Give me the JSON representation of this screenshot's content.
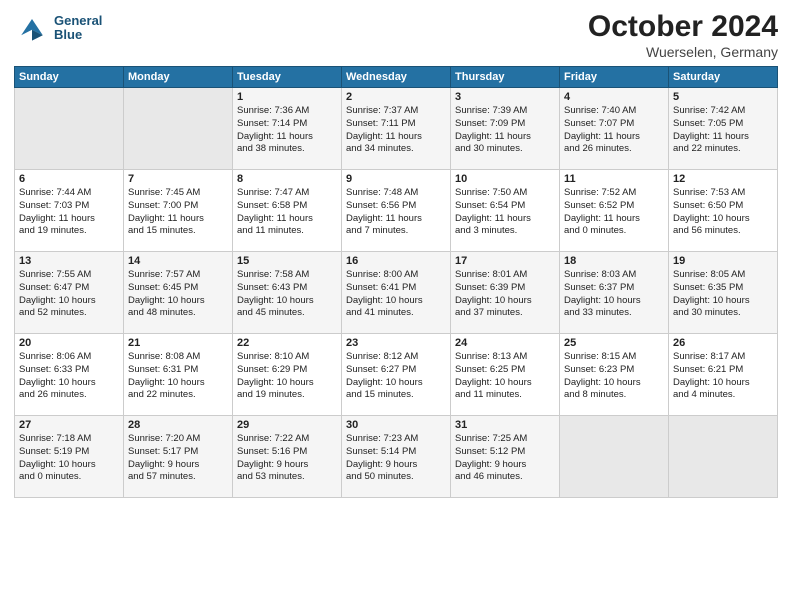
{
  "header": {
    "logo_line1": "General",
    "logo_line2": "Blue",
    "month": "October 2024",
    "location": "Wuerselen, Germany"
  },
  "weekdays": [
    "Sunday",
    "Monday",
    "Tuesday",
    "Wednesday",
    "Thursday",
    "Friday",
    "Saturday"
  ],
  "weeks": [
    [
      {
        "day": "",
        "content": ""
      },
      {
        "day": "",
        "content": ""
      },
      {
        "day": "1",
        "content": "Sunrise: 7:36 AM\nSunset: 7:14 PM\nDaylight: 11 hours\nand 38 minutes."
      },
      {
        "day": "2",
        "content": "Sunrise: 7:37 AM\nSunset: 7:11 PM\nDaylight: 11 hours\nand 34 minutes."
      },
      {
        "day": "3",
        "content": "Sunrise: 7:39 AM\nSunset: 7:09 PM\nDaylight: 11 hours\nand 30 minutes."
      },
      {
        "day": "4",
        "content": "Sunrise: 7:40 AM\nSunset: 7:07 PM\nDaylight: 11 hours\nand 26 minutes."
      },
      {
        "day": "5",
        "content": "Sunrise: 7:42 AM\nSunset: 7:05 PM\nDaylight: 11 hours\nand 22 minutes."
      }
    ],
    [
      {
        "day": "6",
        "content": "Sunrise: 7:44 AM\nSunset: 7:03 PM\nDaylight: 11 hours\nand 19 minutes."
      },
      {
        "day": "7",
        "content": "Sunrise: 7:45 AM\nSunset: 7:00 PM\nDaylight: 11 hours\nand 15 minutes."
      },
      {
        "day": "8",
        "content": "Sunrise: 7:47 AM\nSunset: 6:58 PM\nDaylight: 11 hours\nand 11 minutes."
      },
      {
        "day": "9",
        "content": "Sunrise: 7:48 AM\nSunset: 6:56 PM\nDaylight: 11 hours\nand 7 minutes."
      },
      {
        "day": "10",
        "content": "Sunrise: 7:50 AM\nSunset: 6:54 PM\nDaylight: 11 hours\nand 3 minutes."
      },
      {
        "day": "11",
        "content": "Sunrise: 7:52 AM\nSunset: 6:52 PM\nDaylight: 11 hours\nand 0 minutes."
      },
      {
        "day": "12",
        "content": "Sunrise: 7:53 AM\nSunset: 6:50 PM\nDaylight: 10 hours\nand 56 minutes."
      }
    ],
    [
      {
        "day": "13",
        "content": "Sunrise: 7:55 AM\nSunset: 6:47 PM\nDaylight: 10 hours\nand 52 minutes."
      },
      {
        "day": "14",
        "content": "Sunrise: 7:57 AM\nSunset: 6:45 PM\nDaylight: 10 hours\nand 48 minutes."
      },
      {
        "day": "15",
        "content": "Sunrise: 7:58 AM\nSunset: 6:43 PM\nDaylight: 10 hours\nand 45 minutes."
      },
      {
        "day": "16",
        "content": "Sunrise: 8:00 AM\nSunset: 6:41 PM\nDaylight: 10 hours\nand 41 minutes."
      },
      {
        "day": "17",
        "content": "Sunrise: 8:01 AM\nSunset: 6:39 PM\nDaylight: 10 hours\nand 37 minutes."
      },
      {
        "day": "18",
        "content": "Sunrise: 8:03 AM\nSunset: 6:37 PM\nDaylight: 10 hours\nand 33 minutes."
      },
      {
        "day": "19",
        "content": "Sunrise: 8:05 AM\nSunset: 6:35 PM\nDaylight: 10 hours\nand 30 minutes."
      }
    ],
    [
      {
        "day": "20",
        "content": "Sunrise: 8:06 AM\nSunset: 6:33 PM\nDaylight: 10 hours\nand 26 minutes."
      },
      {
        "day": "21",
        "content": "Sunrise: 8:08 AM\nSunset: 6:31 PM\nDaylight: 10 hours\nand 22 minutes."
      },
      {
        "day": "22",
        "content": "Sunrise: 8:10 AM\nSunset: 6:29 PM\nDaylight: 10 hours\nand 19 minutes."
      },
      {
        "day": "23",
        "content": "Sunrise: 8:12 AM\nSunset: 6:27 PM\nDaylight: 10 hours\nand 15 minutes."
      },
      {
        "day": "24",
        "content": "Sunrise: 8:13 AM\nSunset: 6:25 PM\nDaylight: 10 hours\nand 11 minutes."
      },
      {
        "day": "25",
        "content": "Sunrise: 8:15 AM\nSunset: 6:23 PM\nDaylight: 10 hours\nand 8 minutes."
      },
      {
        "day": "26",
        "content": "Sunrise: 8:17 AM\nSunset: 6:21 PM\nDaylight: 10 hours\nand 4 minutes."
      }
    ],
    [
      {
        "day": "27",
        "content": "Sunrise: 7:18 AM\nSunset: 5:19 PM\nDaylight: 10 hours\nand 0 minutes."
      },
      {
        "day": "28",
        "content": "Sunrise: 7:20 AM\nSunset: 5:17 PM\nDaylight: 9 hours\nand 57 minutes."
      },
      {
        "day": "29",
        "content": "Sunrise: 7:22 AM\nSunset: 5:16 PM\nDaylight: 9 hours\nand 53 minutes."
      },
      {
        "day": "30",
        "content": "Sunrise: 7:23 AM\nSunset: 5:14 PM\nDaylight: 9 hours\nand 50 minutes."
      },
      {
        "day": "31",
        "content": "Sunrise: 7:25 AM\nSunset: 5:12 PM\nDaylight: 9 hours\nand 46 minutes."
      },
      {
        "day": "",
        "content": ""
      },
      {
        "day": "",
        "content": ""
      }
    ]
  ]
}
